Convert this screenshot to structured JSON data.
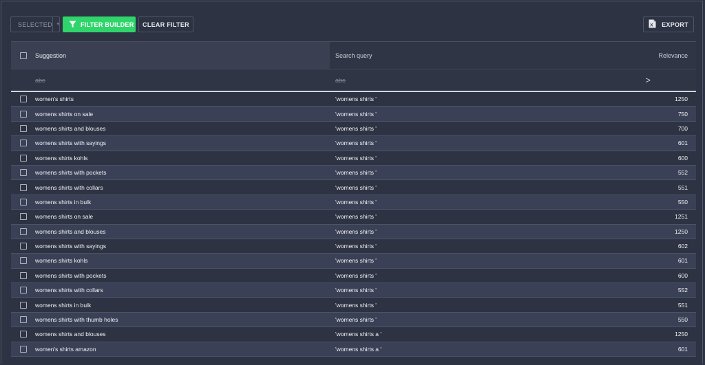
{
  "toolbar": {
    "selected_label": "SELECTED",
    "filter_builder_label": "FILTER BUILDER",
    "clear_filter_label": "CLEAR FILTER",
    "export_label": "EXPORT"
  },
  "columns": {
    "suggestion": "Suggestion",
    "search_query": "Search query",
    "relevance": "Relevance"
  },
  "filter_row": {
    "suggestion_icon_text": "abc",
    "query_icon_text": "abc",
    "relevance_operator": ">"
  },
  "colors": {
    "accent": "#2fd56b",
    "background": "#2d3342",
    "row_alt": "#3a4156"
  },
  "rows": [
    {
      "suggestion": "women's shirts",
      "query": "'womens shirts '",
      "relevance": "1250"
    },
    {
      "suggestion": "womens shirts on sale",
      "query": "'womens shirts '",
      "relevance": "750"
    },
    {
      "suggestion": "womens shirts and blouses",
      "query": "'womens shirts '",
      "relevance": "700"
    },
    {
      "suggestion": "womens shirts with sayings",
      "query": "'womens shirts '",
      "relevance": "601"
    },
    {
      "suggestion": "womens shirts kohls",
      "query": "'womens shirts '",
      "relevance": "600"
    },
    {
      "suggestion": "womens shirts with pockets",
      "query": "'womens shirts '",
      "relevance": "552"
    },
    {
      "suggestion": "womens shirts with collars",
      "query": "'womens shirts '",
      "relevance": "551"
    },
    {
      "suggestion": "womens shirts in bulk",
      "query": "'womens shirts '",
      "relevance": "550"
    },
    {
      "suggestion": "womens shirts on sale",
      "query": "'womens shirts '",
      "relevance": "1251"
    },
    {
      "suggestion": "womens shirts and blouses",
      "query": "'womens shirts '",
      "relevance": "1250"
    },
    {
      "suggestion": "womens shirts with sayings",
      "query": "'womens shirts '",
      "relevance": "602"
    },
    {
      "suggestion": "womens shirts kohls",
      "query": "'womens shirts '",
      "relevance": "601"
    },
    {
      "suggestion": "womens shirts with pockets",
      "query": "'womens shirts '",
      "relevance": "600"
    },
    {
      "suggestion": "womens shirts with collars",
      "query": "'womens shirts '",
      "relevance": "552"
    },
    {
      "suggestion": "womens shirts in bulk",
      "query": "'womens shirts '",
      "relevance": "551"
    },
    {
      "suggestion": "womens shirts with thumb holes",
      "query": "'womens shirts '",
      "relevance": "550"
    },
    {
      "suggestion": "womens shirts and blouses",
      "query": "'womens shirts a '",
      "relevance": "1250"
    },
    {
      "suggestion": "women's shirts amazon",
      "query": "'womens shirts a '",
      "relevance": "601"
    }
  ]
}
